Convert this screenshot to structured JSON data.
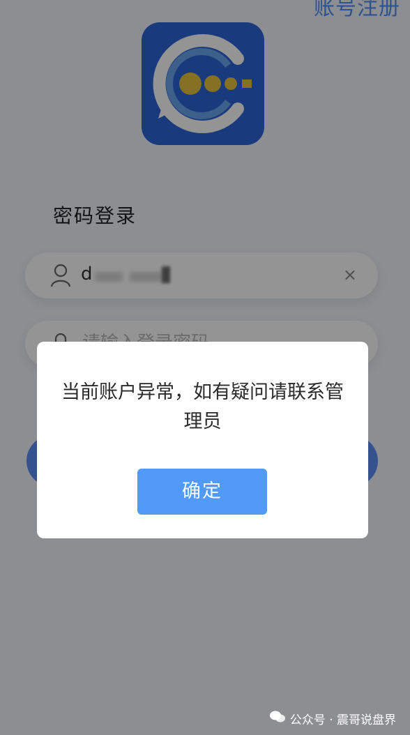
{
  "header": {
    "register_link": "账号注册"
  },
  "login": {
    "title": "密码登录",
    "username": {
      "value": "d"
    },
    "password": {
      "placeholder": "请输入登录密码"
    },
    "clear_icon": "×"
  },
  "dialog": {
    "message": "当前账户异常，如有疑问请联系管理员",
    "confirm_label": "确定"
  },
  "watermark": {
    "text": "公众号 · 震哥说盘界"
  },
  "icons": {
    "user": "user-icon",
    "lock": "lock-icon",
    "clear": "close-icon",
    "wechat": "wechat-icon"
  },
  "colors": {
    "accent": "#519af7",
    "logo_blue": "#2b66d9",
    "logo_dots": "#e5c23f"
  }
}
